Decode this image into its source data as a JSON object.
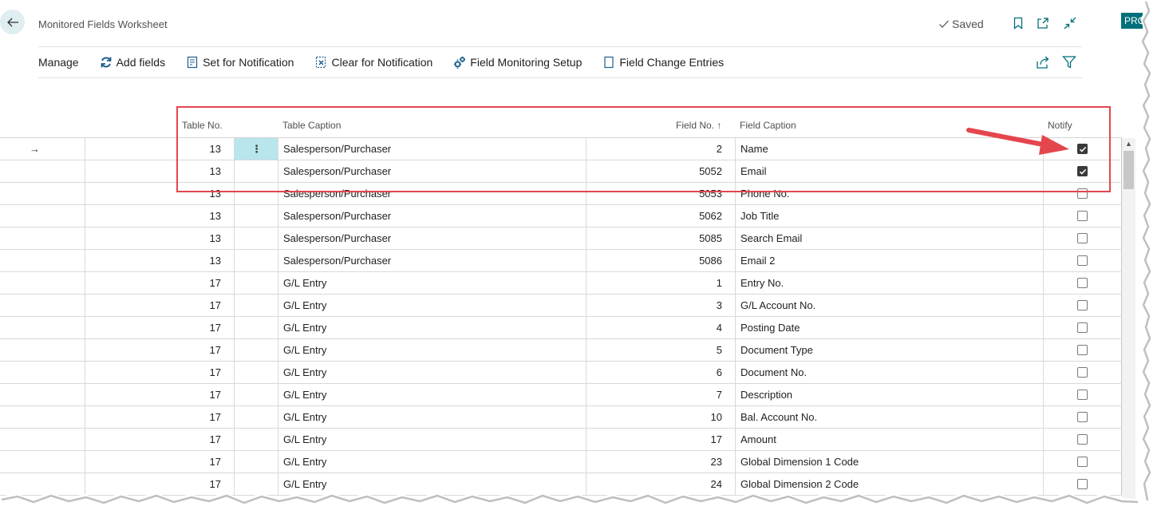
{
  "page": {
    "title": "Monitored Fields Worksheet",
    "saved_label": "Saved",
    "badge": "PRO"
  },
  "icons": {
    "back": "back-arrow-icon",
    "saved": "checkmark-icon",
    "bookmark": "bookmark-icon",
    "open_new": "open-in-new-window-icon",
    "collapse": "collapse-icon",
    "share": "share-icon",
    "filter": "filter-icon",
    "row_selected": "row-arrow-icon"
  },
  "actions": {
    "manage": "Manage",
    "add_fields": "Add fields",
    "set_notification": "Set for Notification",
    "clear_notification": "Clear for Notification",
    "field_monitoring_setup": "Field Monitoring Setup",
    "field_change_entries": "Field Change Entries"
  },
  "columns": {
    "table_no": "Table No.",
    "table_caption": "Table Caption",
    "field_no": "Field No. ↑",
    "field_caption": "Field Caption",
    "notify": "Notify"
  },
  "rows": [
    {
      "table_no": "13",
      "table_caption": "Salesperson/Purchaser",
      "field_no": "2",
      "field_caption": "Name",
      "notify": true
    },
    {
      "table_no": "13",
      "table_caption": "Salesperson/Purchaser",
      "field_no": "5052",
      "field_caption": "Email",
      "notify": true
    },
    {
      "table_no": "13",
      "table_caption": "Salesperson/Purchaser",
      "field_no": "5053",
      "field_caption": "Phone No.",
      "notify": false
    },
    {
      "table_no": "13",
      "table_caption": "Salesperson/Purchaser",
      "field_no": "5062",
      "field_caption": "Job Title",
      "notify": false
    },
    {
      "table_no": "13",
      "table_caption": "Salesperson/Purchaser",
      "field_no": "5085",
      "field_caption": "Search Email",
      "notify": false
    },
    {
      "table_no": "13",
      "table_caption": "Salesperson/Purchaser",
      "field_no": "5086",
      "field_caption": "Email 2",
      "notify": false
    },
    {
      "table_no": "17",
      "table_caption": "G/L Entry",
      "field_no": "1",
      "field_caption": "Entry No.",
      "notify": false
    },
    {
      "table_no": "17",
      "table_caption": "G/L Entry",
      "field_no": "3",
      "field_caption": "G/L Account No.",
      "notify": false
    },
    {
      "table_no": "17",
      "table_caption": "G/L Entry",
      "field_no": "4",
      "field_caption": "Posting Date",
      "notify": false
    },
    {
      "table_no": "17",
      "table_caption": "G/L Entry",
      "field_no": "5",
      "field_caption": "Document Type",
      "notify": false
    },
    {
      "table_no": "17",
      "table_caption": "G/L Entry",
      "field_no": "6",
      "field_caption": "Document No.",
      "notify": false
    },
    {
      "table_no": "17",
      "table_caption": "G/L Entry",
      "field_no": "7",
      "field_caption": "Description",
      "notify": false
    },
    {
      "table_no": "17",
      "table_caption": "G/L Entry",
      "field_no": "10",
      "field_caption": "Bal. Account No.",
      "notify": false
    },
    {
      "table_no": "17",
      "table_caption": "G/L Entry",
      "field_no": "17",
      "field_caption": "Amount",
      "notify": false
    },
    {
      "table_no": "17",
      "table_caption": "G/L Entry",
      "field_no": "23",
      "field_caption": "Global Dimension 1 Code",
      "notify": false
    },
    {
      "table_no": "17",
      "table_caption": "G/L Entry",
      "field_no": "24",
      "field_caption": "Global Dimension 2 Code",
      "notify": false
    }
  ],
  "selected_row": 0,
  "colors": {
    "accent": "#00707a",
    "annotation": "#e5454d",
    "selected_cell": "#b8e6ec"
  }
}
